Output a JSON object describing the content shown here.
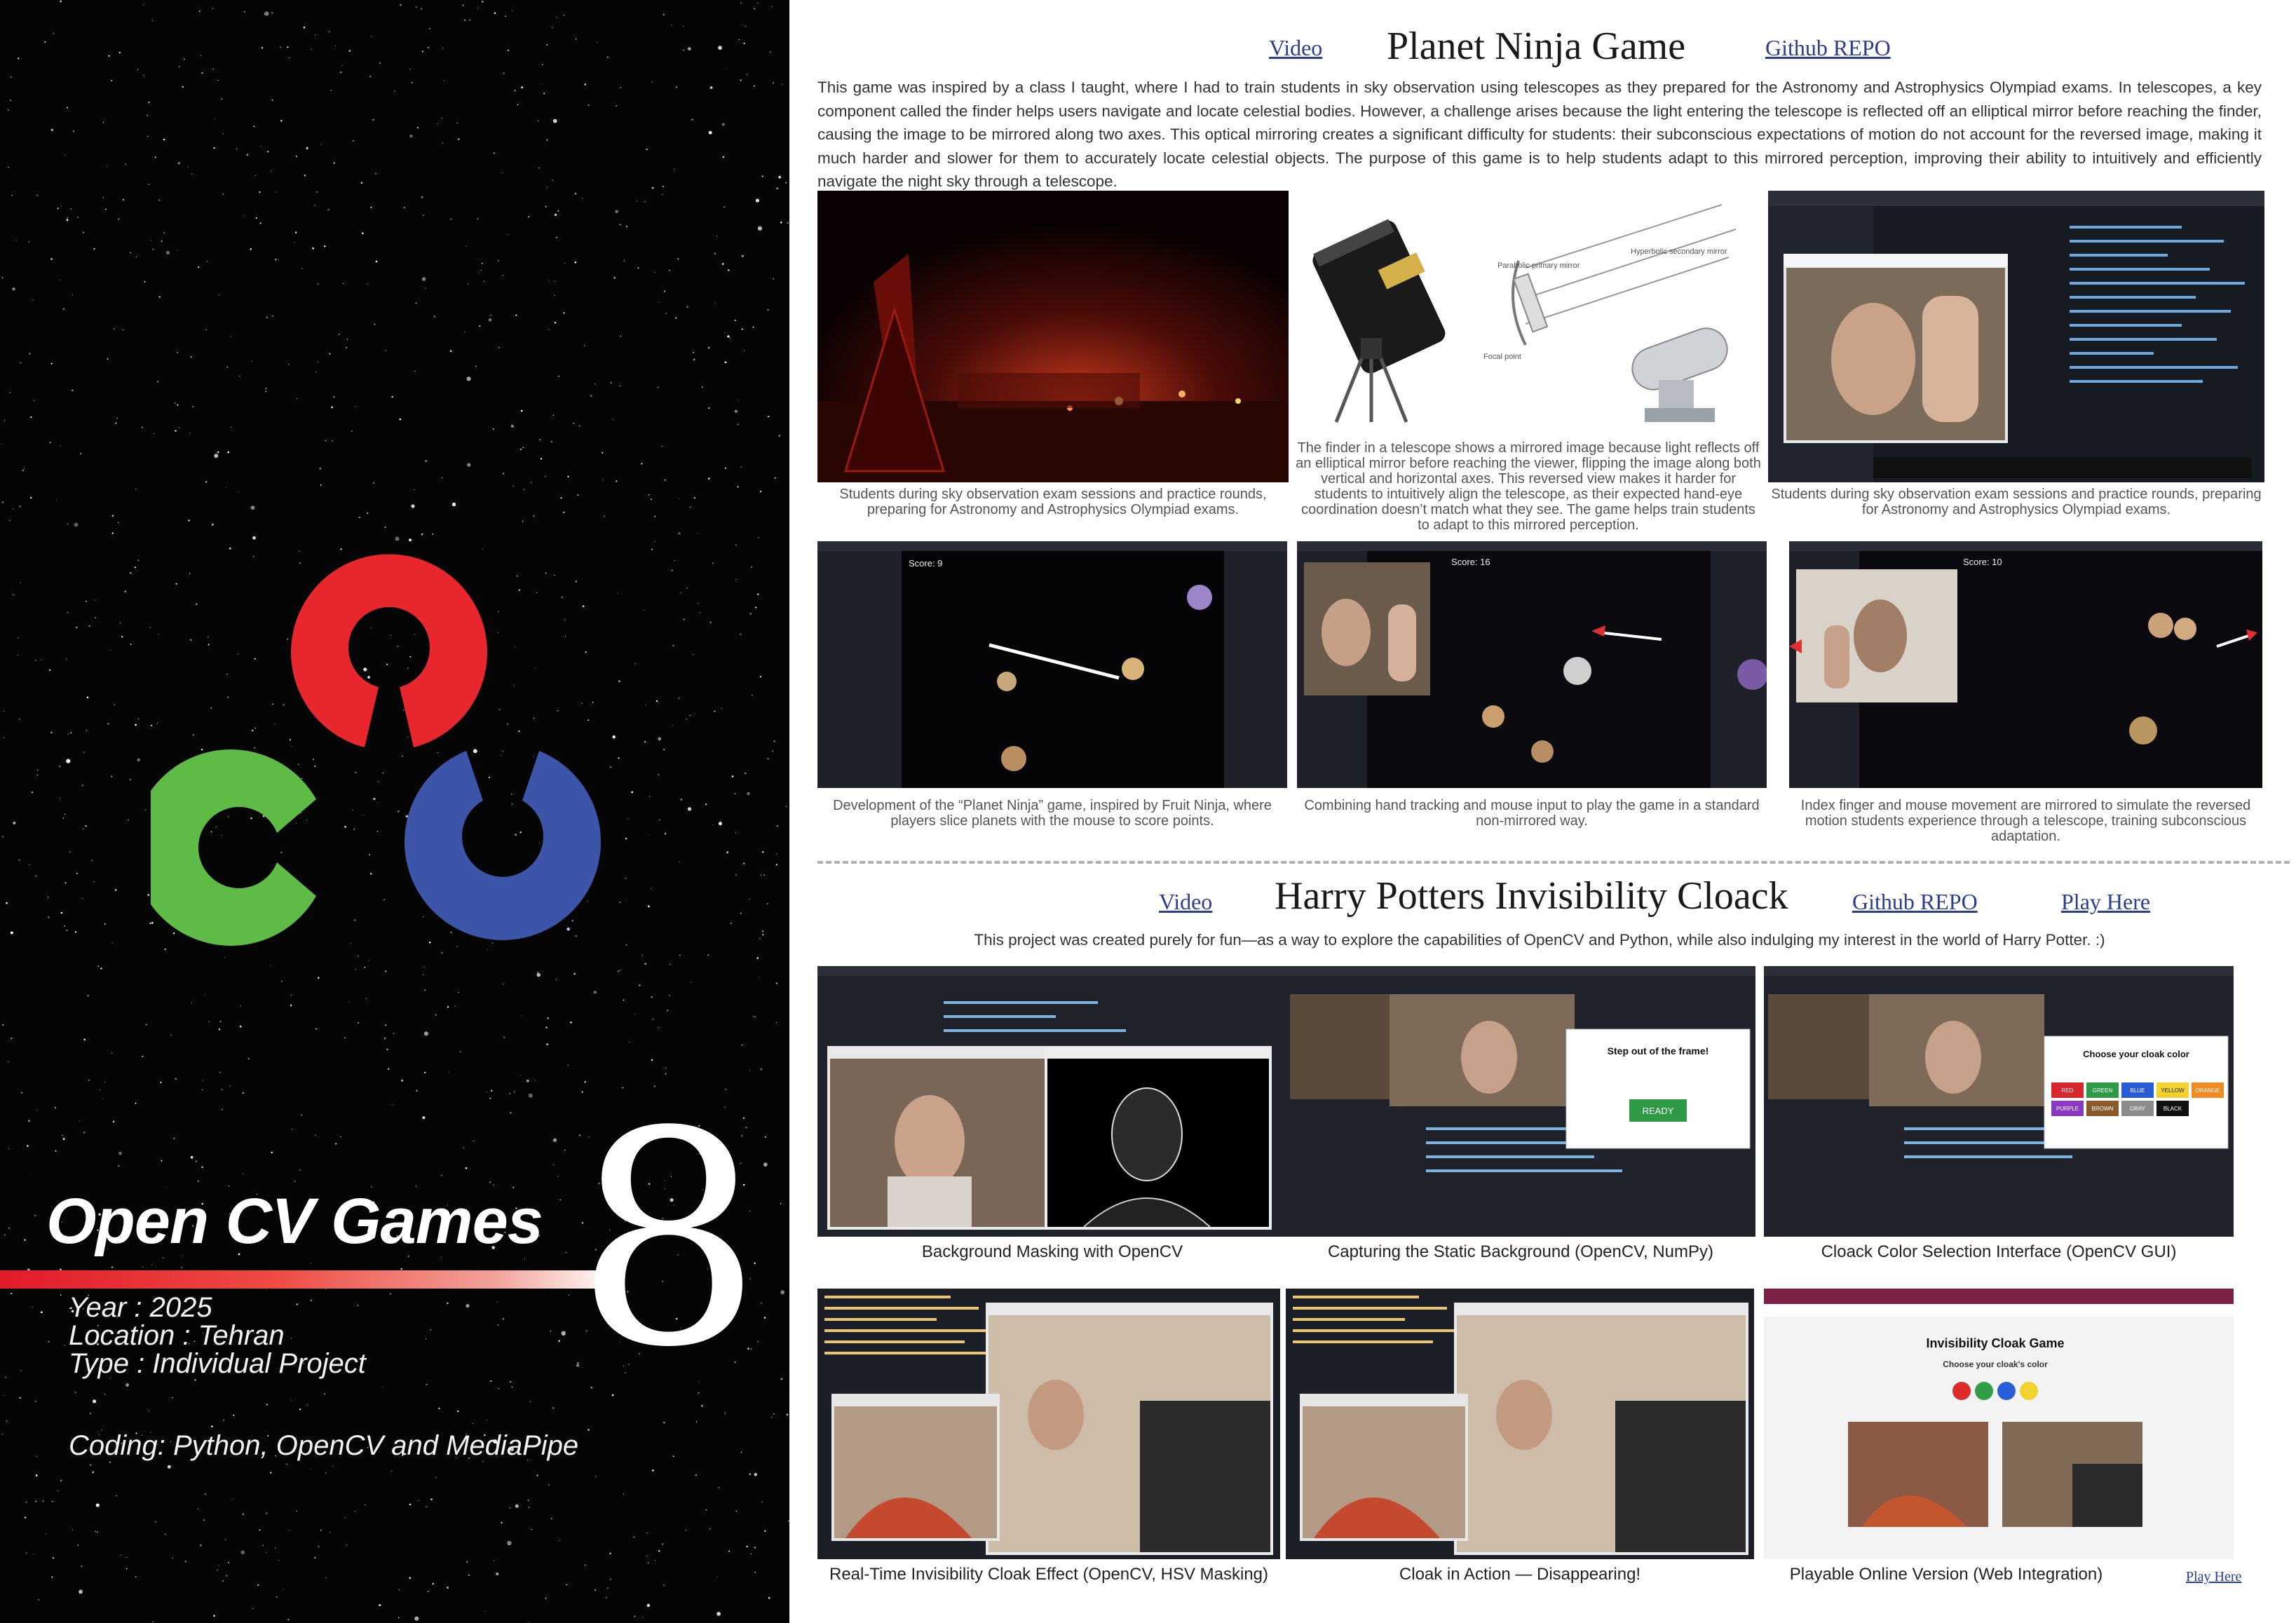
{
  "sidebar": {
    "title": "Open CV Games",
    "number": "8",
    "year": "Year : 2025",
    "location": "Location : Tehran",
    "type": "Type : Individual Project",
    "coding": "Coding: Python, OpenCV and MediaPipe",
    "logo_colors": {
      "red": "#e8262e",
      "green": "#5dbb46",
      "blue": "#3d55a8"
    },
    "accent": "#e21b2a"
  },
  "planet_ninja": {
    "video_link": "Video",
    "title": "Planet Ninja Game",
    "github_link": "Github REPO",
    "description": "This game was inspired by a class I taught, where I had to train students in sky observation using telescopes as they prepared for the Astronomy and Astrophysics Olympiad exams. In telescopes, a key component called the finder helps users navigate and locate celestial bodies. However, a challenge arises because the light entering the telescope is reflected off an elliptical mirror before reaching the finder, causing the image to be mirrored along two axes. This optical mirroring creates a significant difficulty for students: their subconscious expectations of motion do not account for the reversed image, making it much harder and slower for them to accurately locate celestial objects. The purpose of this game is to help students adapt to this mirrored perception, improving their ability to intuitively and efficiently navigate the night sky through a telescope.",
    "captions": [
      "Students during sky observation exam sessions and practice rounds, preparing for Astronomy and Astrophysics Olympiad exams.",
      "The finder in a telescope shows a mirrored image because light reflects off an elliptical mirror before reaching the viewer, flipping the image along both vertical and horizontal axes. This reversed view makes it harder for students to intuitively align the telescope, as their expected hand-eye coordination doesn’t match what they see. The game helps train students to adapt to this mirrored perception.",
      "Students during sky observation exam sessions and practice rounds, preparing for Astronomy and Astrophysics Olympiad exams.",
      "Development of the “Planet Ninja” game, inspired by Fruit Ninja, where players slice planets with the mouse to score points.",
      "Combining hand tracking and mouse input to play the game in a standard non-mirrored way.",
      "Index finger and mouse movement are mirrored to simulate the reversed motion students experience through a telescope, training subconscious adaptation."
    ],
    "diagram_labels": {
      "primary": "Parabolic primary mirror",
      "secondary": "Hyperbolic secondary mirror",
      "focal": "Focal point"
    },
    "scores": [
      "Score: 9",
      "Score: 16",
      "Score: 10"
    ]
  },
  "invisibility": {
    "video_link": "Video",
    "title": "Harry Potters Invisibility Cloack",
    "github_link": "Github REPO",
    "play_link": "Play Here",
    "description": "This project was created purely for fun—as a way to explore the capabilities of OpenCV and Python, while also indulging my interest in the world of Harry Potter. :)",
    "captions": [
      "Background Masking with OpenCV",
      "Capturing the Static Background (OpenCV, NumPy)",
      "Cloack Color Selection Interface (OpenCV GUI)",
      "Real-Time Invisibility Cloak Effect (OpenCV, HSV Masking)",
      "Cloak in Action — Disappearing!",
      "Playable Online Version (Web Integration)"
    ],
    "play_link_small": "Play Here",
    "dialog_step_out": "Step out of the frame!",
    "dialog_ready": "READY",
    "dialog_choose": "Choose your cloak color",
    "color_buttons": [
      "RED",
      "GREEN",
      "BLUE",
      "YELLOW",
      "ORANGE",
      "PURPLE",
      "BROWN",
      "GRAY",
      "BLACK"
    ],
    "web_title": "Invisibility Cloak Game",
    "web_subtitle": "Choose your cloak's color"
  }
}
